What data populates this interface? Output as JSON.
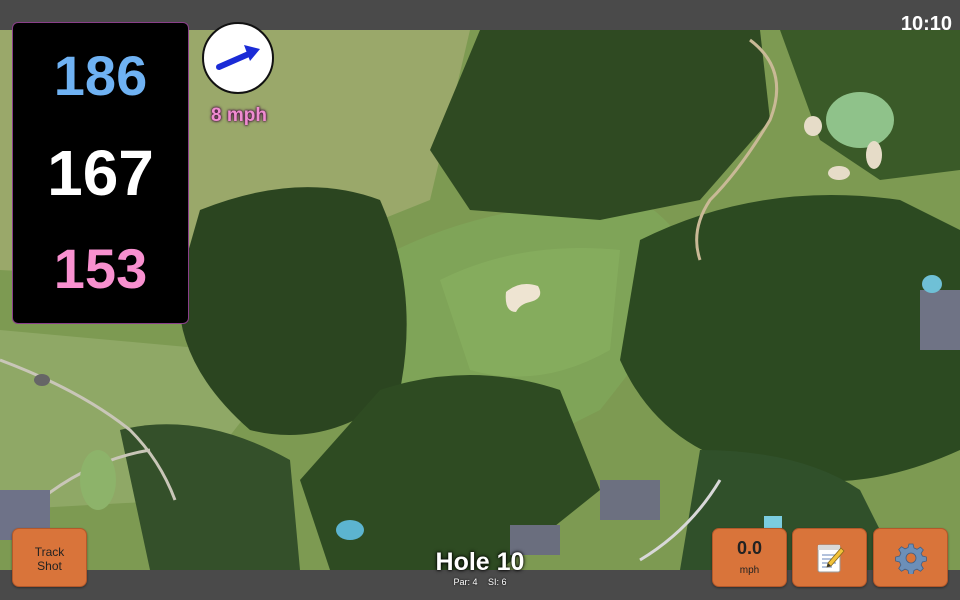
{
  "status_bar": {
    "time": "10:10"
  },
  "distances": {
    "back": "186",
    "middle": "167",
    "front": "153",
    "back_color": "#6fb2f3",
    "middle_color": "#ffffff",
    "front_color": "#f890cf"
  },
  "wind": {
    "speed_label": "8 mph",
    "direction_icon": "wind-arrow-icon",
    "arrow_color": "#1a2bd6"
  },
  "hole": {
    "title": "Hole 10",
    "par_label": "Par: 4",
    "si_label": "SI: 6"
  },
  "buttons": {
    "track_shot_line1": "Track",
    "track_shot_line2": "Shot",
    "speed_value": "0.0",
    "speed_unit": "mph",
    "notes_icon": "notepad-icon",
    "settings_icon": "gear-icon",
    "color": "#d9743a"
  },
  "map": {
    "type": "satellite-golf-hole"
  }
}
